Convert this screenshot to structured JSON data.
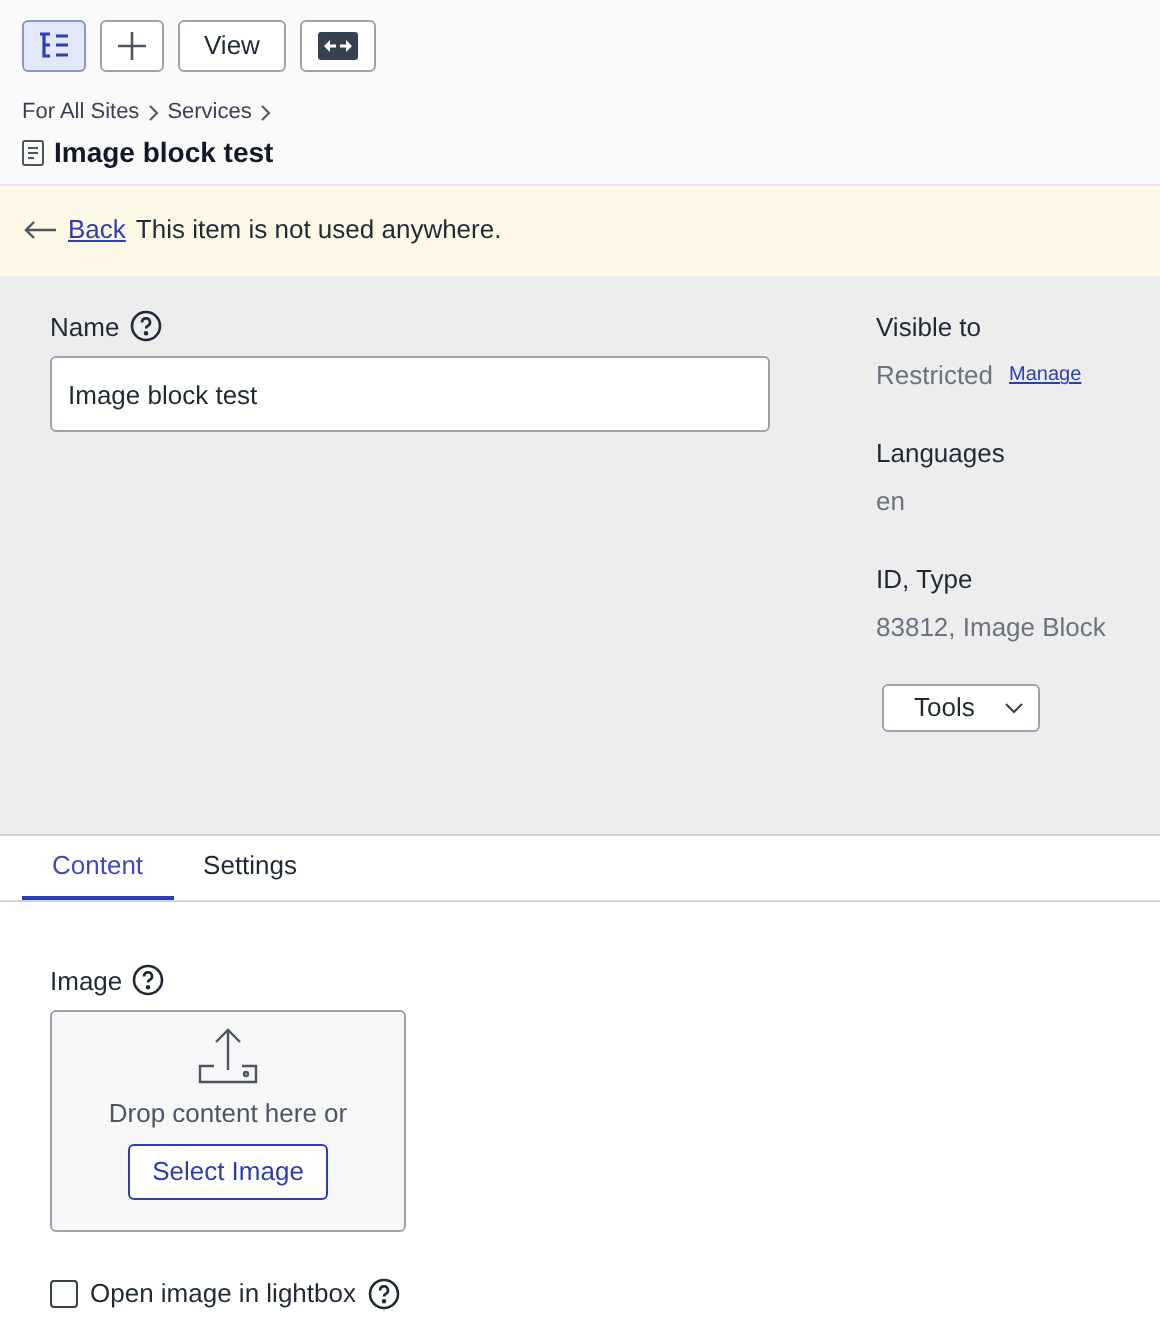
{
  "toolbar": [
    {
      "kind": "tree",
      "selected": true
    },
    {
      "kind": "add",
      "selected": false
    },
    {
      "kind": "text",
      "label": "View",
      "selected": false
    },
    {
      "kind": "expand",
      "selected": false
    }
  ],
  "breadcrumb": [
    "For All Sites",
    "Services"
  ],
  "title": "Image block test",
  "notice": {
    "link": "Back",
    "text": "This item is not used anywhere."
  },
  "name_field": {
    "label": "Name",
    "value": "Image block test"
  },
  "info": [
    {
      "label": "Visible to",
      "value": "Restricted",
      "link": "Manage"
    },
    {
      "label": "Languages",
      "value": "en"
    },
    {
      "label": "ID, Type",
      "value": "83812, Image Block"
    }
  ],
  "tools_button": "Tools",
  "tabs": [
    {
      "label": "Content",
      "selected": true
    },
    {
      "label": "Settings",
      "selected": false
    }
  ],
  "image_field": {
    "label": "Image",
    "drop_text": "Drop content here or",
    "button": "Select Image"
  },
  "lightbox": {
    "label": "Open image in lightbox",
    "checked": false
  }
}
